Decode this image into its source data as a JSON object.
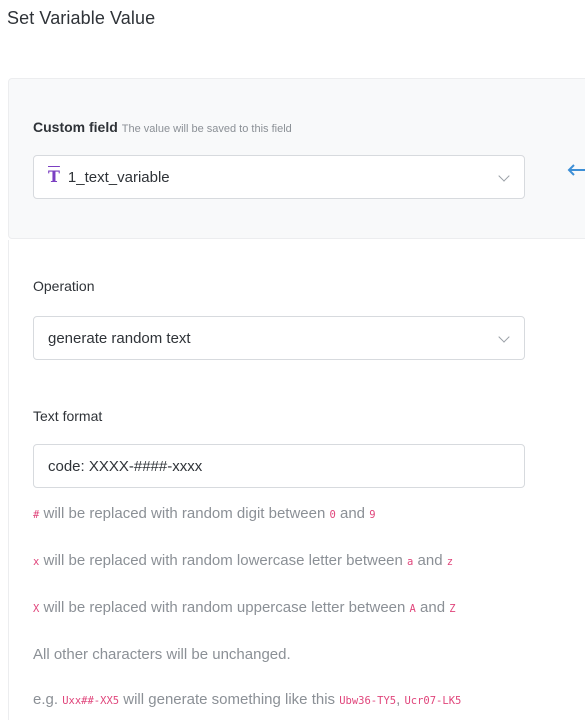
{
  "page": {
    "title": "Set Variable Value"
  },
  "custom_field": {
    "label": "Custom field",
    "hint": "The value will be saved to this field",
    "selected_value": "1_text_variable",
    "icon": "text-type-icon",
    "arrow_color": "#3d8fd6"
  },
  "operation": {
    "label": "Operation",
    "selected_value": "generate random text"
  },
  "text_format": {
    "label": "Text format",
    "value": "code: XXXX-####-xxxx"
  },
  "help": {
    "line1": {
      "token": "#",
      "text1": " will be replaced with random digit between ",
      "from": "0",
      "and": " and ",
      "to": "9"
    },
    "line2": {
      "token": "x",
      "text1": " will be replaced with random lowercase letter between ",
      "from": "a",
      "and": " and ",
      "to": "z"
    },
    "line3": {
      "token": "X",
      "text1": " will be replaced with random uppercase letter between ",
      "from": "A",
      "and": " and ",
      "to": "Z"
    },
    "line4": "All other characters will be unchanged.",
    "line5": {
      "prefix": "e.g. ",
      "pattern": "Uxx##-XX5",
      "text1": " will generate something like this ",
      "example1": "Ubw36-TY5",
      "sep": ", ",
      "example2": "Ucr07-LK5"
    }
  },
  "colors": {
    "accent_code": "#e0457b",
    "icon_purple": "#7b3fc2"
  }
}
